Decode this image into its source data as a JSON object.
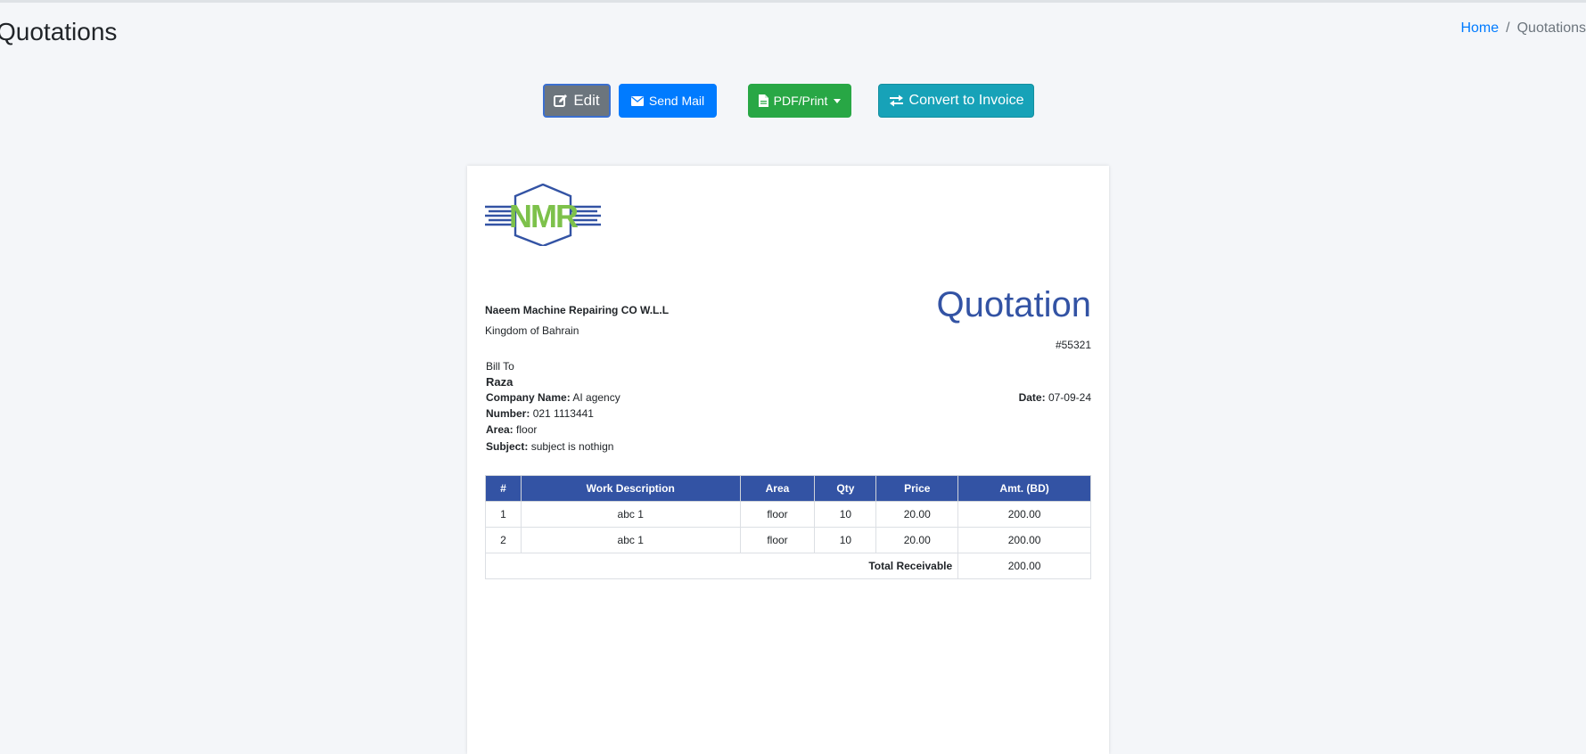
{
  "page": {
    "title": "Quotations"
  },
  "breadcrumb": {
    "home": "Home",
    "separator": "/",
    "current": "Quotations"
  },
  "toolbar": {
    "edit_label": "Edit",
    "send_mail_label": "Send Mail",
    "pdf_print_label": "PDF/Print",
    "convert_label": "Convert to Invoice"
  },
  "colors": {
    "edit": "#6c757d",
    "send_mail": "#007bff",
    "pdf_print": "#28a745",
    "convert": "#17a2b8",
    "accent": "#3353a4",
    "logo_green": "#7dc14b"
  },
  "icons": {
    "edit": "edit-icon",
    "send_mail": "envelope-icon",
    "pdf_print": "file-icon",
    "convert": "exchange-icon",
    "dropdown": "caret-down-icon"
  },
  "document": {
    "logo_text": "NMR",
    "company_name": "Naeem Machine Repairing CO W.L.L",
    "company_country": "Kingdom of Bahrain",
    "title": "Quotation",
    "number": "#55321",
    "bill_to_label": "Bill To",
    "client_name": "Raza",
    "company_label": "Company Name:",
    "company_value": "AI agency",
    "number_label": "Number:",
    "number_value": "021 1113441",
    "area_label": "Area:",
    "area_value": "floor",
    "subject_label": "Subject:",
    "subject_value": "subject is nothign",
    "date_label": "Date:",
    "date_value": "07-09-24"
  },
  "table": {
    "headers": [
      "#",
      "Work Description",
      "Area",
      "Qty",
      "Price",
      "Amt. (BD)"
    ],
    "rows": [
      [
        "1",
        "abc 1",
        "floor",
        "10",
        "20.00",
        "200.00"
      ],
      [
        "2",
        "abc 1",
        "floor",
        "10",
        "20.00",
        "200.00"
      ]
    ],
    "total_label": "Total Receivable",
    "total_value": "200.00"
  }
}
